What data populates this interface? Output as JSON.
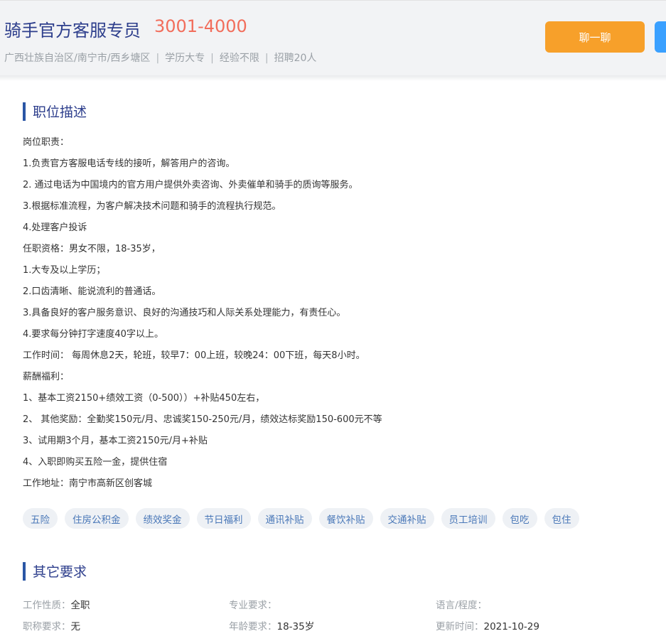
{
  "header": {
    "title": "骑手官方客服专员",
    "salary": "3001-4000",
    "meta": [
      "广西壮族自治区/南宁市/西乡塘区",
      "学历大专",
      "经验不限",
      "招聘20人"
    ],
    "chat_button": "聊一聊"
  },
  "description": {
    "heading": "职位描述",
    "lines": [
      "岗位职责：",
      "1.负责官方客服电话专线的接听，解答用户的咨询。",
      "2. 通过电话为中国境内的官方用户提供外卖咨询、外卖催单和骑手的质询等服务。",
      "3.根据标准流程，为客户解决技术问题和骑手的流程执行规范。",
      "4.处理客户投诉",
      "任职资格：男女不限，18-35岁，",
      "1.大专及以上学历；",
      "2.口齿清晰、能说流利的普通话。",
      "3.具备良好的客户服务意识、良好的沟通技巧和人际关系处理能力，有责任心。",
      "4.要求每分钟打字速度40字以上。",
      "工作时间： 每周休息2天，轮班，较早7：00上班，较晚24：00下班，每天8小时。",
      "薪酬福利：",
      "1、基本工资2150+绩效工资（0-500））+补贴450左右，",
      "2、 其他奖励：全勤奖150元/月、忠诚奖150-250元/月，绩效达标奖励150-600元不等",
      "3、试用期3个月，基本工资2150元/月+补贴",
      "4、入职即购买五险一金，提供住宿",
      "工作地址：南宁市高新区创客城"
    ]
  },
  "tags": [
    "五险",
    "住房公积金",
    "绩效奖金",
    "节日福利",
    "通讯补贴",
    "餐饮补贴",
    "交通补贴",
    "员工培训",
    "包吃",
    "包住"
  ],
  "other": {
    "heading": "其它要求",
    "rows": [
      [
        {
          "key": "工作性质：",
          "value": "全职"
        },
        {
          "key": "专业要求：",
          "value": ""
        },
        {
          "key": "语言/程度：",
          "value": ""
        }
      ],
      [
        {
          "key": "职称要求：",
          "value": "无"
        },
        {
          "key": "年龄要求：",
          "value": "18-35岁"
        },
        {
          "key": "更新时间：",
          "value": "2021-10-29"
        }
      ]
    ]
  }
}
